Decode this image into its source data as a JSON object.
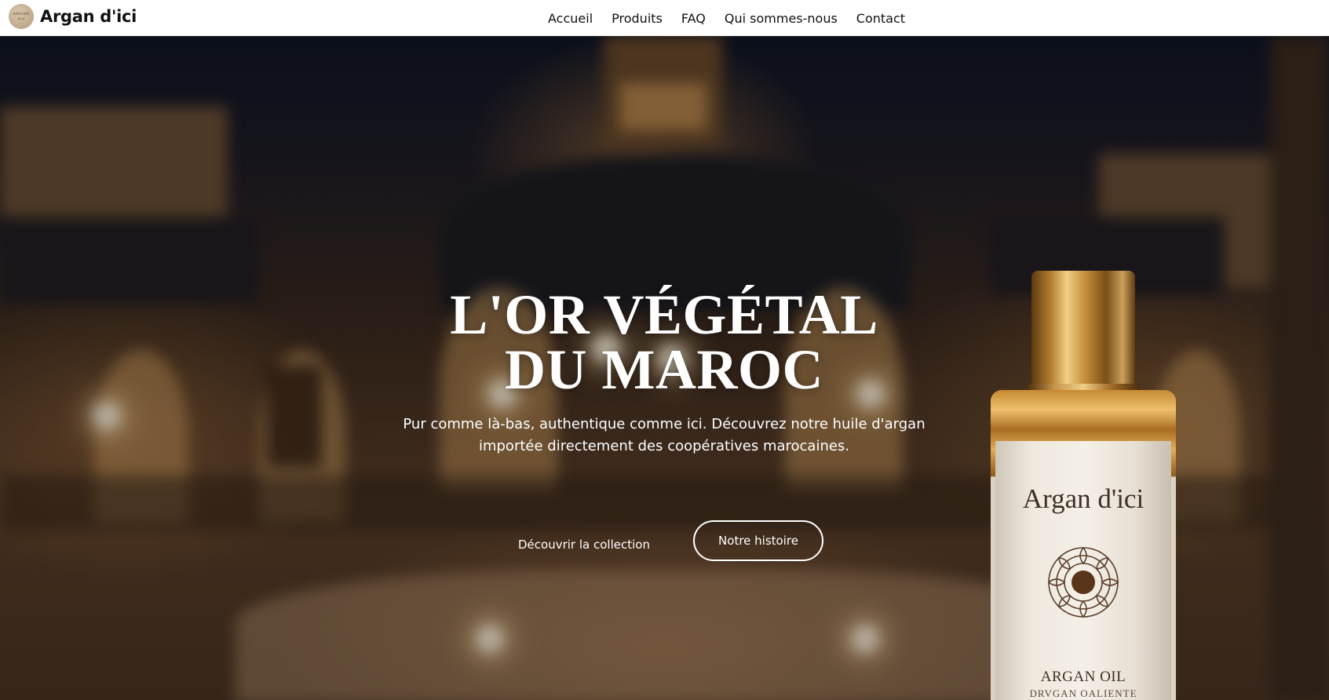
{
  "nav": {
    "brand_name": "Argan d'ici",
    "logo_text_top": "ARGAN",
    "logo_text_bottom": "d'ici",
    "links": [
      "Accueil",
      "Produits",
      "FAQ",
      "Qui sommes-nous",
      "Contact"
    ]
  },
  "hero": {
    "title_line1": "L'OR VÉGÉTAL",
    "title_line2": "DU MAROC",
    "subtitle": "Pur comme là-bas, authentique comme ici. Découvrez notre huile d'argan importée directement des coopératives marocaines.",
    "primary_cta": "Découvrir la collection",
    "secondary_cta": "Notre histoire"
  },
  "product": {
    "label_brand": "Argan d'ici",
    "label_product": "ARGAN OIL",
    "label_sub": "DRVGAN OALIENTE"
  },
  "colors": {
    "nav_background": "#ffffff",
    "hero_text": "#ffffff",
    "gold_accent": "#c9954a"
  },
  "icons": {
    "bottle_emblem": "mandala-emblem-icon"
  }
}
